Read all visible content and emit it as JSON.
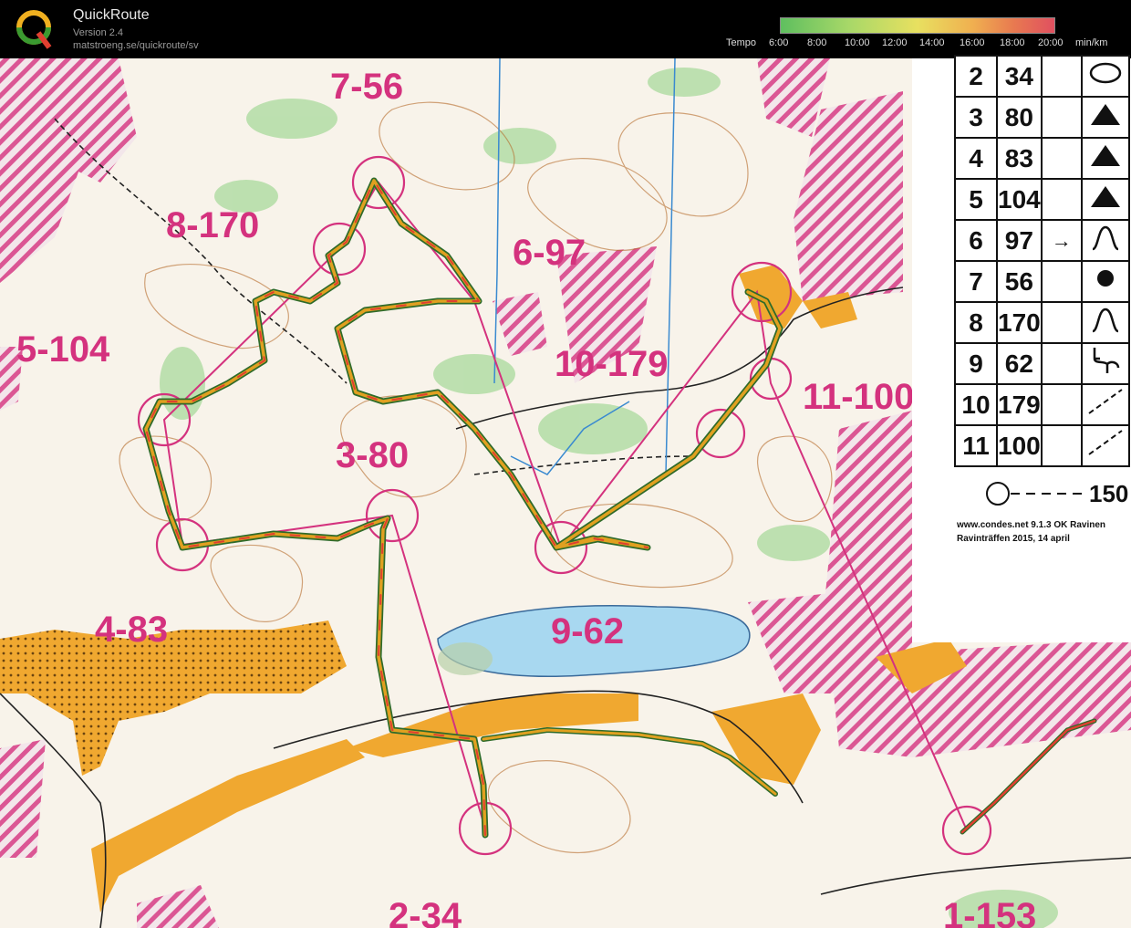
{
  "app": {
    "title": "QuickRoute",
    "version": "Version 2.4",
    "url": "matstroeng.se/quickroute/sv"
  },
  "tempo": {
    "label": "Tempo",
    "ticks": [
      "6:00",
      "8:00",
      "10:00",
      "12:00",
      "14:00",
      "16:00",
      "18:00",
      "20:00"
    ],
    "unit": "min/km"
  },
  "controls": [
    {
      "label": "7-56"
    },
    {
      "label": "8-170"
    },
    {
      "label": "6-97"
    },
    {
      "label": "5-104"
    },
    {
      "label": "10-179"
    },
    {
      "label": "11-100"
    },
    {
      "label": "3-80"
    },
    {
      "label": "4-83"
    },
    {
      "label": "9-62"
    },
    {
      "label": "2-34"
    },
    {
      "label": "1-153"
    }
  ],
  "description_sheet": {
    "rows": [
      {
        "num": "2",
        "code": "34",
        "symbol": "ellipse-symbol"
      },
      {
        "num": "3",
        "code": "80",
        "symbol": "triangle-symbol"
      },
      {
        "num": "4",
        "code": "83",
        "symbol": "triangle-symbol"
      },
      {
        "num": "5",
        "code": "104",
        "symbol": "triangle-symbol"
      },
      {
        "num": "6",
        "code": "97",
        "arrow": "→",
        "symbol": "knoll-symbol"
      },
      {
        "num": "7",
        "code": "56",
        "symbol": "dot-symbol"
      },
      {
        "num": "8",
        "code": "170",
        "symbol": "knoll-symbol"
      },
      {
        "num": "9",
        "code": "62",
        "symbol": "junction-symbol"
      },
      {
        "num": "10",
        "code": "179",
        "symbol": "diagonal-symbol"
      },
      {
        "num": "11",
        "code": "100",
        "symbol": "diagonal-symbol"
      }
    ],
    "finish_distance": "150",
    "credit_line1": "www.condes.net 9.1.3 OK Ravinen",
    "credit_line2": "Ravinträffen 2015, 14 april"
  },
  "colors": {
    "course": "#d4327e",
    "route_outer": "#2f6b2a",
    "route_inner": "#e0a020",
    "forest_green": "#9fd39a",
    "open_yellow": "#f0a830",
    "water": "#a8d8f0"
  }
}
